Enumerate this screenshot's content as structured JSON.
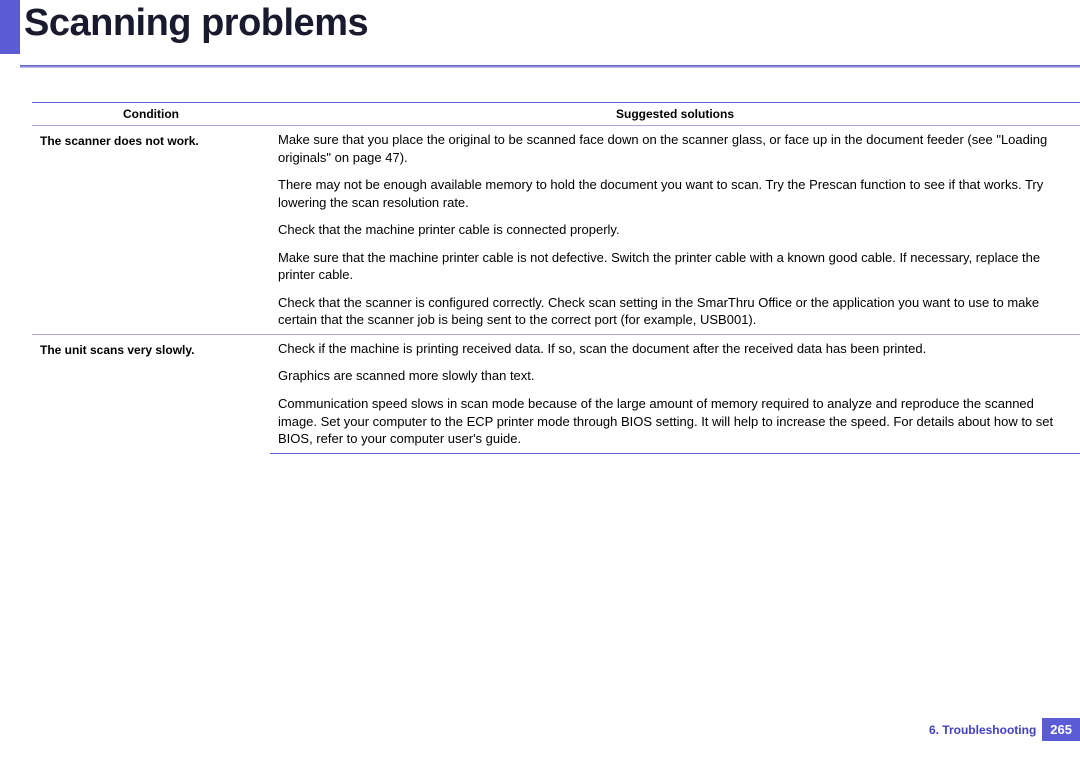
{
  "title": "Scanning problems",
  "table": {
    "headers": {
      "condition": "Condition",
      "solution": "Suggested solutions"
    },
    "rows": [
      {
        "condition": "The scanner does not work.",
        "solutions": [
          "Make sure that you place the original to be scanned face down on the scanner glass, or face up in the document feeder (see \"Loading originals\" on page 47).",
          "There may not be enough available memory to hold the document you want to scan. Try the Prescan function to see if that works. Try lowering the scan resolution rate.",
          "Check that the machine printer cable is connected properly.",
          "Make sure that the machine printer cable is not defective. Switch the printer cable with a known good cable. If necessary, replace the printer cable.",
          "Check that the scanner is configured correctly. Check scan setting in the SmarThru Office or the application you want to use to make certain that the scanner job is being sent to the correct port (for example, USB001)."
        ]
      },
      {
        "condition": "The unit scans very slowly.",
        "solutions": [
          "Check if the machine is printing received data. If so, scan the document after the received data has been printed.",
          "Graphics are scanned more slowly than text.",
          "Communication speed slows in scan mode because of the large amount of memory required to analyze and reproduce the scanned image. Set your computer to the ECP printer mode through BIOS setting. It will help to increase the speed. For details about how to set BIOS, refer to your computer user's guide."
        ]
      }
    ]
  },
  "footer": {
    "chapter": "6. Troubleshooting",
    "page": "265"
  }
}
